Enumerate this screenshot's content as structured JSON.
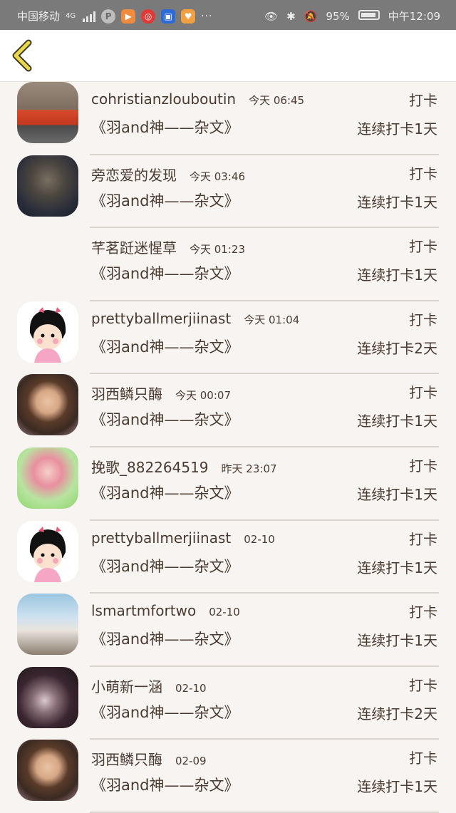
{
  "status_bar": {
    "carrier": "中国移动",
    "network": "4G",
    "battery": "95%",
    "time": "中午12:09",
    "dots": "···"
  },
  "header": {
    "back_icon": "chevron-left-icon",
    "accent": "#e8d84a"
  },
  "rows": [
    {
      "name": "cohristianzlouboutin",
      "time": "今天 06:45",
      "title": "《羽and神——杂文》",
      "checkin": "打卡",
      "streak": "连续打卡1天",
      "avatar": "sports-car"
    },
    {
      "name": "旁恋爱的发现",
      "time": "今天 03:46",
      "title": "《羽and神——杂文》",
      "checkin": "打卡",
      "streak": "连续打卡1天",
      "avatar": "dark-portrait"
    },
    {
      "name": "芊茗跹迷惺草",
      "time": "今天 01:23",
      "title": "《羽and神——杂文》",
      "checkin": "打卡",
      "streak": "连续打卡1天",
      "avatar": "none"
    },
    {
      "name": "prettyballmerjiinast",
      "time": "今天 01:04",
      "title": "《羽and神——杂文》",
      "checkin": "打卡",
      "streak": "连续打卡2天",
      "avatar": "cartoon-girl"
    },
    {
      "name": "羽西鳞只酶",
      "time": "今天 00:07",
      "title": "《羽and神——杂文》",
      "checkin": "打卡",
      "streak": "连续打卡1天",
      "avatar": "curly-child"
    },
    {
      "name": "挽歌_882264519",
      "time": "昨天 23:07",
      "title": "《羽and神——杂文》",
      "checkin": "打卡",
      "streak": "连续打卡1天",
      "avatar": "anime-pink"
    },
    {
      "name": "prettyballmerjiinast",
      "time": "02-10",
      "title": "《羽and神——杂文》",
      "checkin": "打卡",
      "streak": "连续打卡1天",
      "avatar": "cartoon-girl"
    },
    {
      "name": "lsmartmfortwo",
      "time": "02-10",
      "title": "《羽and神——杂文》",
      "checkin": "打卡",
      "streak": "连续打卡1天",
      "avatar": "horse-rider"
    },
    {
      "name": "小萌新一涵",
      "time": "02-10",
      "title": "《羽and神——杂文》",
      "checkin": "打卡",
      "streak": "连续打卡2天",
      "avatar": "dark-hair"
    },
    {
      "name": "羽西鳞只酶",
      "time": "02-09",
      "title": "《羽and神——杂文》",
      "checkin": "打卡",
      "streak": "连续打卡1天",
      "avatar": "curly-child"
    }
  ]
}
